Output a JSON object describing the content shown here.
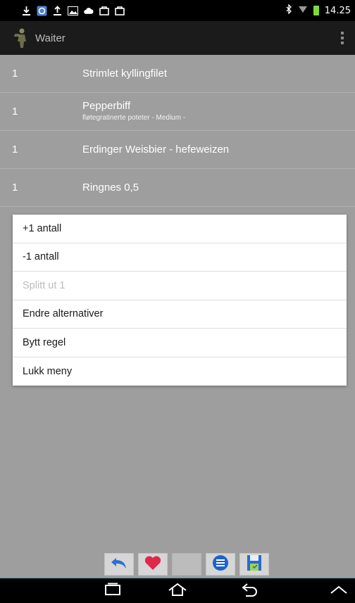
{
  "status_bar": {
    "time": "14.25",
    "icons": [
      "download-icon",
      "sync-icon",
      "upload-icon",
      "image-icon",
      "cloud-icon",
      "bag-icon",
      "bag-icon"
    ],
    "battery_color": "#7fd93a"
  },
  "action_bar": {
    "title": "Waiter"
  },
  "orders": [
    {
      "qty": "1",
      "name": "Strimlet kyllingfilet",
      "options": ""
    },
    {
      "qty": "1",
      "name": "Pepperbiff",
      "options": "fløtegratinerte poteter - Medium -"
    },
    {
      "qty": "1",
      "name": "Erdinger Weisbier - hefeweizen",
      "options": ""
    },
    {
      "qty": "1",
      "name": "Ringnes 0,5",
      "options": ""
    }
  ],
  "context_menu": {
    "items": [
      {
        "label": "+1 antall",
        "enabled": true
      },
      {
        "label": "-1 antall",
        "enabled": true
      },
      {
        "label": "Splitt ut 1",
        "enabled": false
      },
      {
        "label": "Endre alternativer",
        "enabled": true
      },
      {
        "label": "Bytt regel",
        "enabled": true
      },
      {
        "label": "Lukk meny",
        "enabled": true
      }
    ]
  },
  "toolbar": {
    "buttons": [
      "undo-icon",
      "heart-icon",
      "empty",
      "list-icon",
      "save-icon"
    ]
  },
  "nav_bar": {
    "buttons": [
      "recent-apps-icon",
      "home-icon",
      "back-icon",
      "up-chevron-icon"
    ]
  },
  "colors": {
    "list_background": "#9e9e9e",
    "action_bar": "#1b1b1b",
    "accent_line": "#3aa6c8",
    "heart": "#e0284a",
    "undo": "#2d6fd0"
  }
}
